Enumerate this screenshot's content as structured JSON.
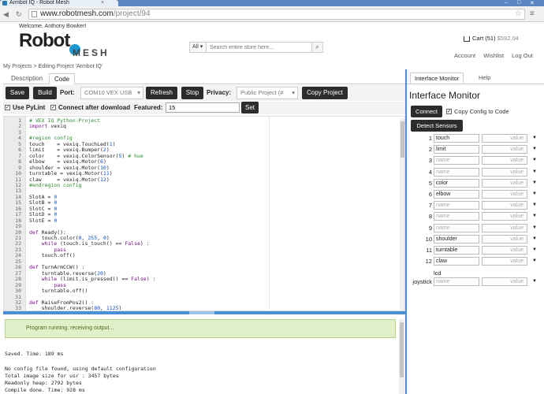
{
  "browser": {
    "tab_title": "Armbot IQ - Robot Mesh",
    "url_host": "www.robotmesh.com",
    "url_path": "/project/94"
  },
  "site": {
    "welcome": "Welcome, Anthony Bowker!",
    "logo_robot": "Robot",
    "logo_mesh": "MESH",
    "search_category": "All",
    "search_placeholder": "Search entire store here...",
    "cart_label": "Cart (51)",
    "cart_price": "$592.04",
    "account_links": [
      "Account",
      "Wishlist",
      "Log Out"
    ],
    "breadcrumb": "My Projects > Editing Project 'Armbot IQ'"
  },
  "editor_tabs": [
    {
      "label": "Description",
      "active": false
    },
    {
      "label": "Code",
      "active": true
    }
  ],
  "toolbar": {
    "save_label": "Save",
    "build_label": "Build",
    "port_label": "Port:",
    "port_value": "COM10 VEX USB",
    "refresh_label": "Refresh",
    "stop_label": "Stop",
    "privacy_label": "Privacy:",
    "privacy_value": "Public Project (#",
    "copy_project_label": "Copy Project",
    "use_pylint_label": "Use PyLint",
    "connect_after_label": "Connect after download",
    "featured_label": "Featured:",
    "featured_value": "15",
    "set_label": "Set"
  },
  "code_lines": [
    {
      "n": "1",
      "t": "# VEX IQ Python-Project"
    },
    {
      "n": "2",
      "t": "import vexiq"
    },
    {
      "n": "3",
      "t": ""
    },
    {
      "n": "4",
      "t": "#region config"
    },
    {
      "n": "5",
      "t": "touch    = vexiq.TouchLed(1)"
    },
    {
      "n": "6",
      "t": "limit    = vexiq.Bumper(2)"
    },
    {
      "n": "7",
      "t": "color    = vexiq.ColorSensor(5) # hue"
    },
    {
      "n": "8",
      "t": "elbow    = vexiq.Motor(6)"
    },
    {
      "n": "9",
      "t": "shoulder = vexiq.Motor(10)"
    },
    {
      "n": "10",
      "t": "turntable = vexiq.Motor(11)"
    },
    {
      "n": "11",
      "t": "claw     = vexiq.Motor(12)"
    },
    {
      "n": "12",
      "t": "#endregion config"
    },
    {
      "n": "13",
      "t": ""
    },
    {
      "n": "14",
      "t": "SlotA = 0"
    },
    {
      "n": "15",
      "t": "SlotB = 0"
    },
    {
      "n": "16",
      "t": "SlotC = 0"
    },
    {
      "n": "17",
      "t": "SlotD = 0"
    },
    {
      "n": "18",
      "t": "SlotE = 0"
    },
    {
      "n": "19",
      "t": ""
    },
    {
      "n": "20",
      "t": "def Ready():"
    },
    {
      "n": "21",
      "t": "    touch.color(0, 255, 0)"
    },
    {
      "n": "22",
      "t": "    while (touch.is_touch() == False) :"
    },
    {
      "n": "23",
      "t": "        pass"
    },
    {
      "n": "24",
      "t": "    touch.off()"
    },
    {
      "n": "25",
      "t": ""
    },
    {
      "n": "26",
      "t": "def TurnArmCCW() :"
    },
    {
      "n": "27",
      "t": "    turntable.reverse(20)"
    },
    {
      "n": "28",
      "t": "    while (limit.is_pressed() == False) :"
    },
    {
      "n": "29",
      "t": "        pass"
    },
    {
      "n": "30",
      "t": "    turntable.off()"
    },
    {
      "n": "31",
      "t": ""
    },
    {
      "n": "32",
      "t": "def RaiseFromPos2() :"
    },
    {
      "n": "33",
      "t": "    shoulder.reverse(80, 1125)"
    }
  ],
  "console": {
    "banner": "Program running, receiving output...",
    "lines": [
      "Saved. Time: 189 ms",
      "",
      "No config file found, using default configuration",
      "Total image size for usr : 3457 bytes",
      "Readonly heap: 2792 bytes",
      "Compile done. Time: 928 ms"
    ]
  },
  "right_tabs": [
    {
      "label": "Interface Monitor",
      "active": true
    },
    {
      "label": "Help",
      "active": false
    }
  ],
  "monitor": {
    "title": "Interface Monitor",
    "connect_label": "Connect",
    "copy_config_label": "Copy Config to Code",
    "detect_label": "Detect Sensors",
    "value_placeholder": "value",
    "name_placeholder": "name",
    "ports": [
      {
        "num": "1",
        "name": "touch"
      },
      {
        "num": "2",
        "name": "limit"
      },
      {
        "num": "3",
        "name": ""
      },
      {
        "num": "4",
        "name": ""
      },
      {
        "num": "5",
        "name": "color"
      },
      {
        "num": "6",
        "name": "elbow"
      },
      {
        "num": "7",
        "name": ""
      },
      {
        "num": "8",
        "name": ""
      },
      {
        "num": "9",
        "name": ""
      },
      {
        "num": "10",
        "name": "shoulder"
      },
      {
        "num": "11",
        "name": "turntable"
      },
      {
        "num": "12",
        "name": "claw"
      }
    ],
    "lcd_label": "lcd",
    "joystick_label": "joystick"
  }
}
